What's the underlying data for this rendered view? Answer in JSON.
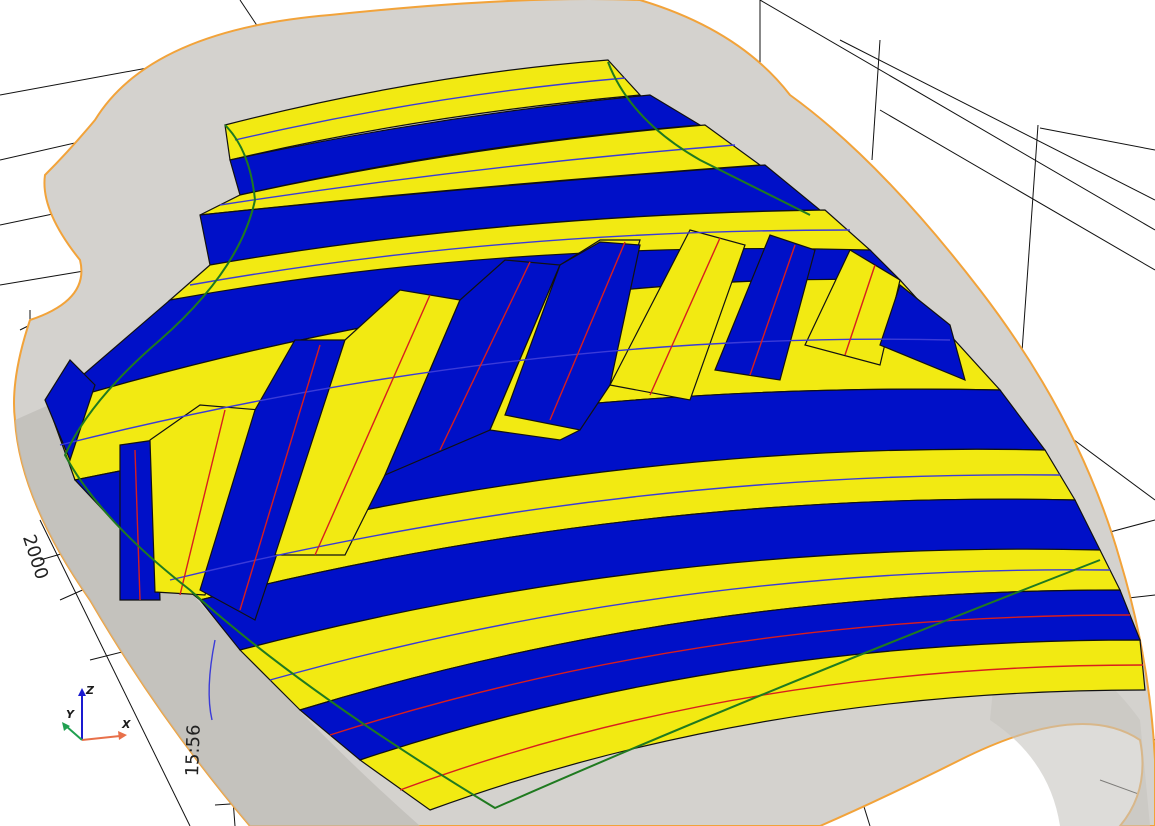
{
  "viewport": {
    "background": "#ffffff",
    "colors": {
      "surface": "#d4d2ce",
      "surface_edge": "#f2a33a",
      "ply_yellow": "#f2ea12",
      "ply_blue": "#0010c8",
      "fiber_red": "#d81e1e",
      "fiber_blue": "#3b3bd8",
      "boundary_green": "#1f7a1f",
      "grid_line": "#111111"
    }
  },
  "dimensions": {
    "left_label": "2000",
    "bottom_label": "15:56"
  },
  "axis_triad": {
    "x_label": "X",
    "y_label": "Y",
    "z_label": "Z",
    "x_color": "#e8704a",
    "y_color": "#20a050",
    "z_color": "#1a1ad0"
  }
}
